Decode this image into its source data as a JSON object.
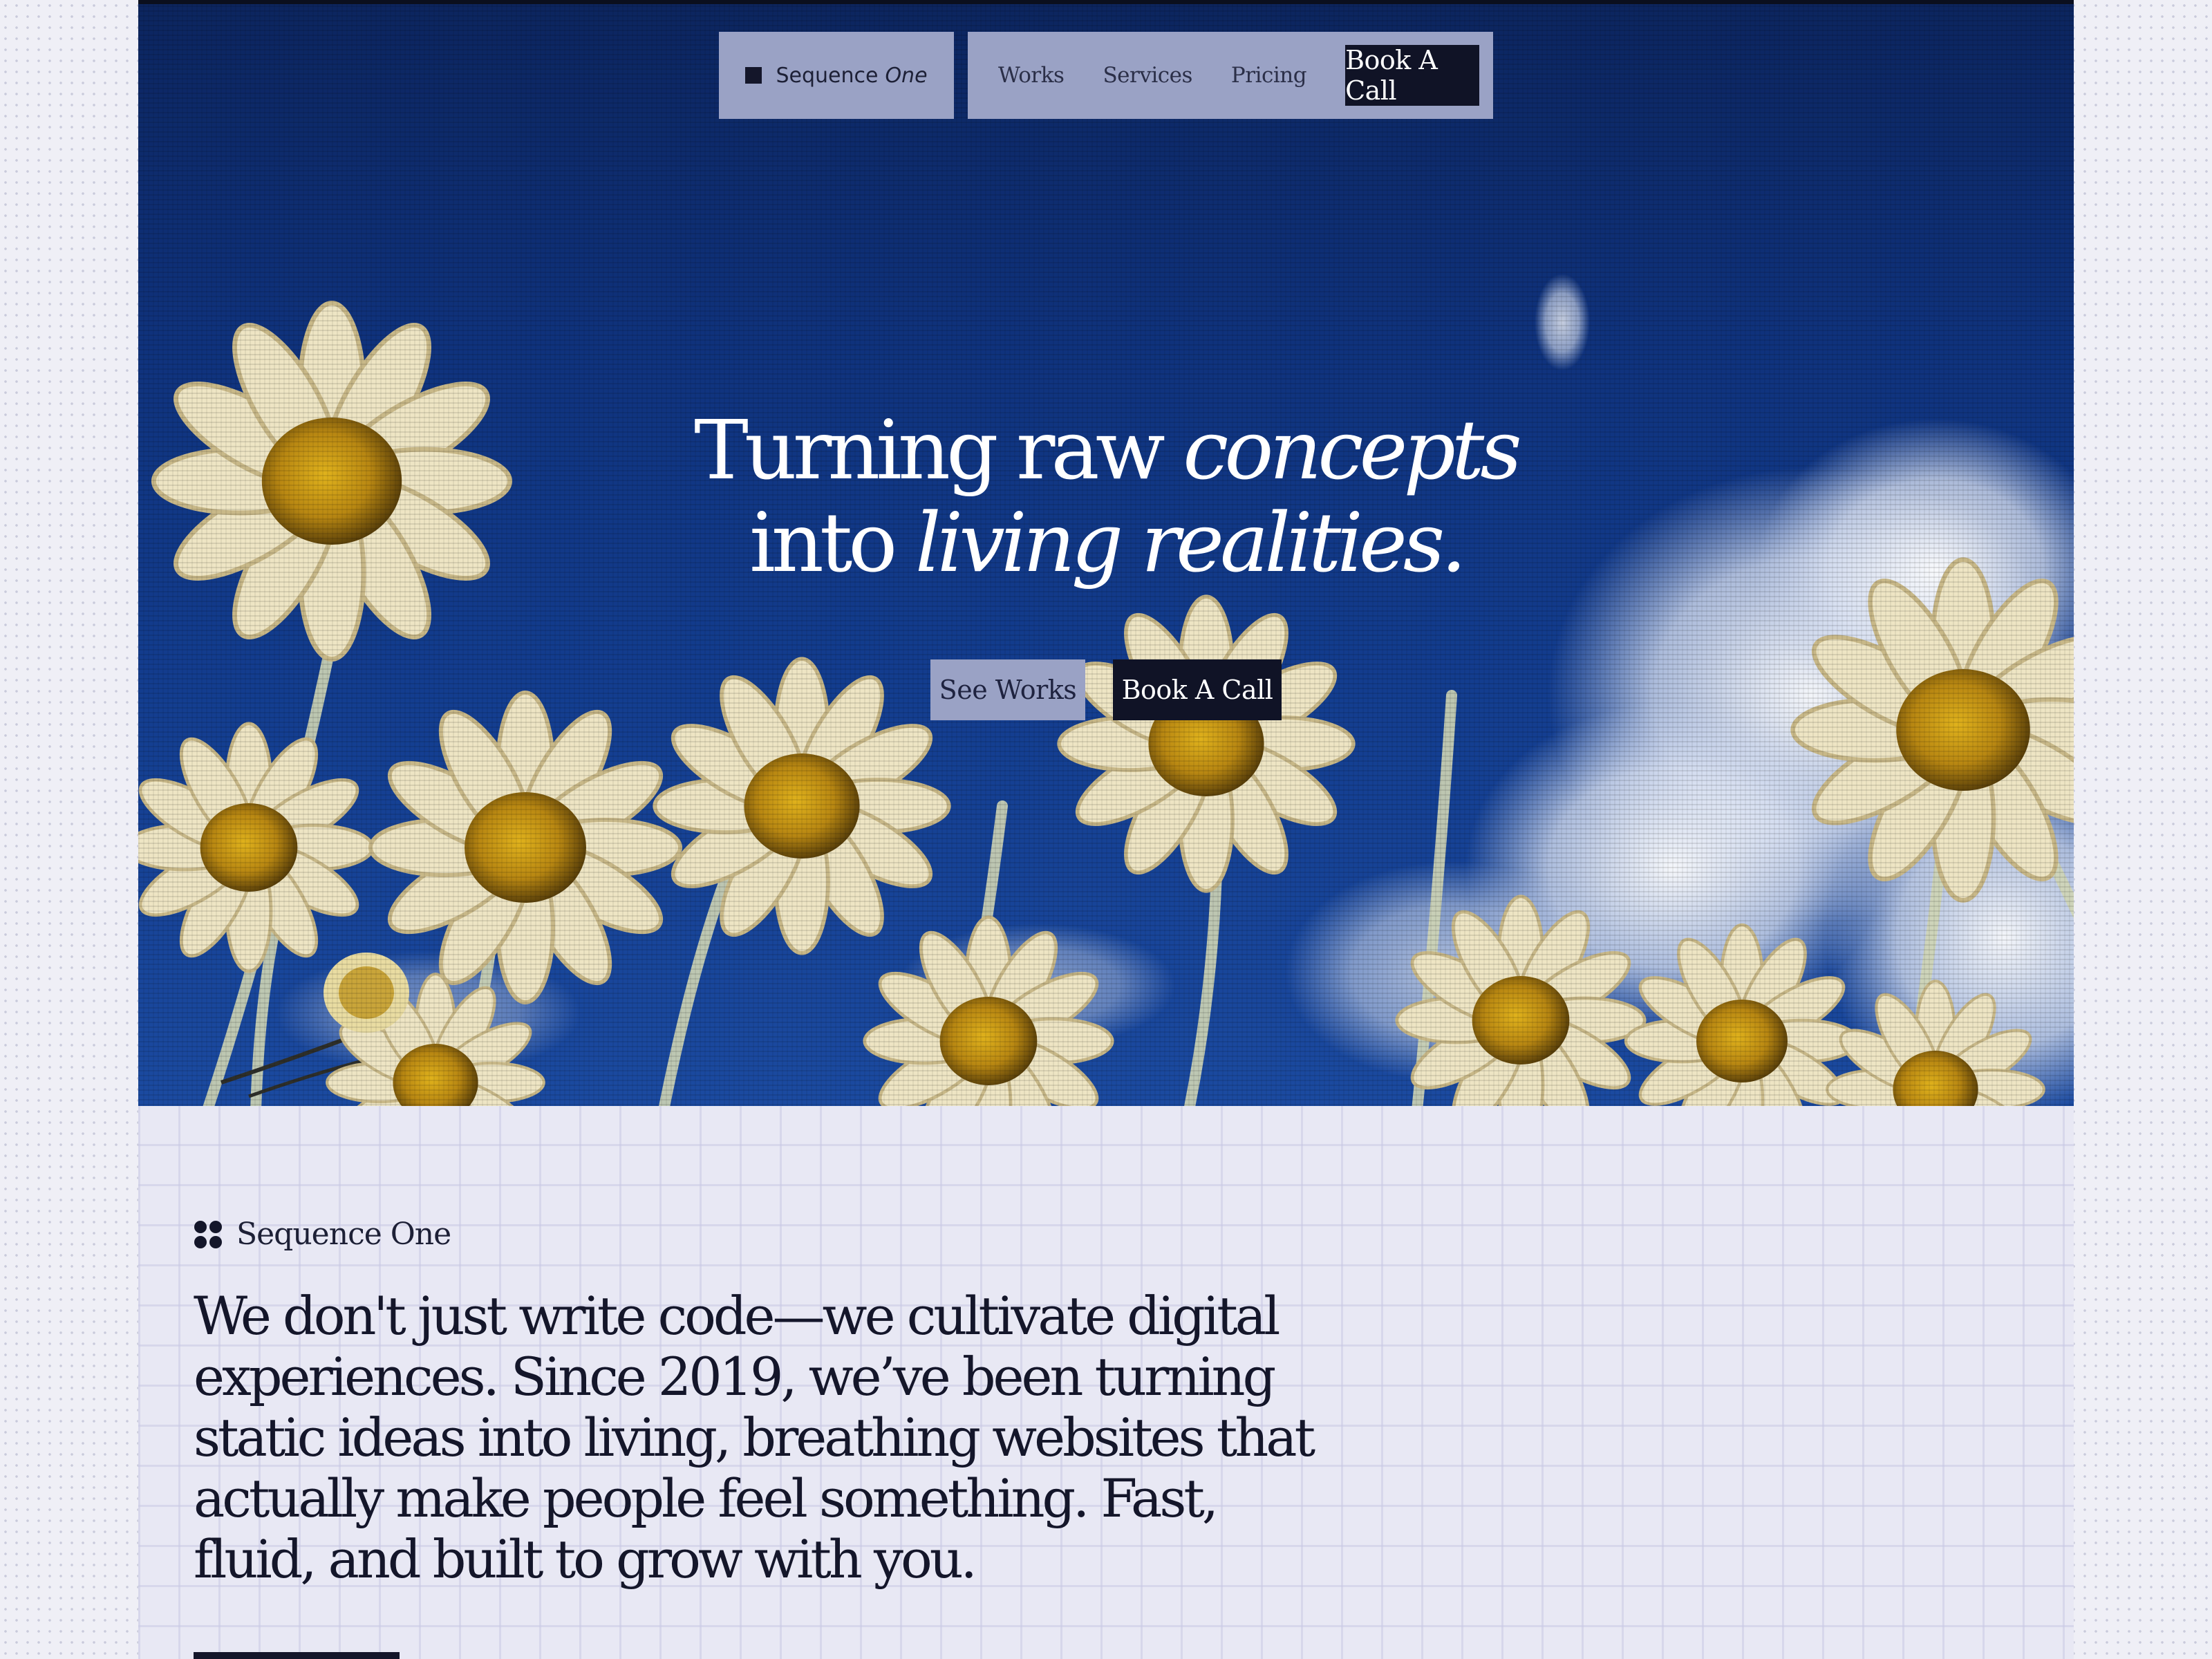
{
  "nav": {
    "brand": {
      "name": "Sequence",
      "suffix": "One"
    },
    "links": [
      "Works",
      "Services",
      "Pricing"
    ],
    "cta": "Book A Call"
  },
  "hero": {
    "title_line1_plain": "Turning raw",
    "title_line1_italic": "concepts",
    "title_line2_plain": "into",
    "title_line2_italic": "living realities.",
    "buttons": {
      "secondary": "See Works",
      "primary": "Book A Call"
    },
    "background": "daisies against blue sky"
  },
  "intro": {
    "kicker": "Sequence One",
    "text": "We don't just write code—we cultivate digital experiences. Since 2019, we’ve been turning static ideas into living, breathing websites that actually make people feel something. Fast, fluid, and built to grow with you."
  },
  "colors": {
    "accent_dark": "#101326",
    "nav_surface": "#9aa2c5",
    "sky": "#133d8f",
    "page_bg": "#e9e9f4"
  },
  "icons": {
    "brand": "square-logo-icon",
    "kicker": "four-dots-icon"
  }
}
